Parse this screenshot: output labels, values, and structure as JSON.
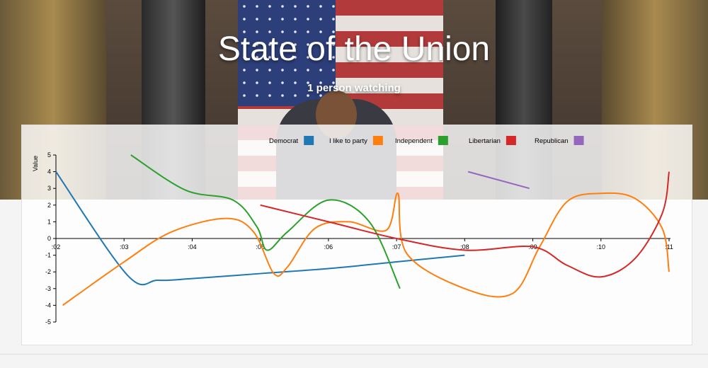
{
  "header": {
    "title": "State of the Union",
    "subtitle": "1 person watching"
  },
  "chart_data": {
    "type": "line",
    "ylabel": "Value",
    "xlabel": "",
    "ylim": [
      -5,
      5
    ],
    "x_ticks": [
      ":02",
      ":03",
      ":04",
      ":05",
      ":06",
      ":07",
      ":08",
      ":09",
      ":10",
      ":11"
    ],
    "y_ticks": [
      5,
      4,
      3,
      2,
      1,
      0,
      -1,
      -2,
      -3,
      -4,
      -5
    ],
    "legend_placement": "top",
    "series": [
      {
        "name": "Democrat",
        "color": "#1f77b4",
        "points": [
          [
            2.0,
            4.0
          ],
          [
            3.05,
            -2.2
          ],
          [
            3.5,
            -2.5
          ],
          [
            4.0,
            -2.4
          ],
          [
            5.0,
            -2.1
          ],
          [
            6.0,
            -1.8
          ],
          [
            7.0,
            -1.4
          ],
          [
            8.0,
            -1.0
          ]
        ]
      },
      {
        "name": "I like to party",
        "color": "#ff7f0e",
        "points": [
          [
            2.1,
            -4.0
          ],
          [
            3.0,
            -1.4
          ],
          [
            3.7,
            0.4
          ],
          [
            4.5,
            1.2
          ],
          [
            4.9,
            0.4
          ],
          [
            5.2,
            -2.1
          ],
          [
            5.4,
            -1.7
          ],
          [
            5.8,
            0.6
          ],
          [
            6.3,
            1.0
          ],
          [
            6.85,
            0.5
          ],
          [
            7.02,
            2.7
          ],
          [
            7.15,
            -0.9
          ],
          [
            8.0,
            -3.0
          ],
          [
            8.7,
            -3.3
          ],
          [
            9.1,
            -0.5
          ],
          [
            9.5,
            2.2
          ],
          [
            10.0,
            2.7
          ],
          [
            10.5,
            2.4
          ],
          [
            10.9,
            0.6
          ],
          [
            11.0,
            -2.0
          ]
        ]
      },
      {
        "name": "Independent",
        "color": "#2ca02c",
        "points": [
          [
            3.1,
            5.0
          ],
          [
            3.9,
            2.9
          ],
          [
            4.6,
            2.3
          ],
          [
            4.95,
            0.7
          ],
          [
            5.1,
            -0.7
          ],
          [
            5.4,
            0.4
          ],
          [
            6.0,
            2.3
          ],
          [
            6.6,
            1.0
          ],
          [
            7.05,
            -3.0
          ]
        ]
      },
      {
        "name": "Libertarian",
        "color": "#d62728",
        "points": [
          [
            5.0,
            2.0
          ],
          [
            6.0,
            1.0
          ],
          [
            7.0,
            0.0
          ],
          [
            8.0,
            -0.7
          ],
          [
            9.0,
            -0.5
          ],
          [
            9.5,
            -1.6
          ],
          [
            10.0,
            -2.3
          ],
          [
            10.5,
            -1.2
          ],
          [
            10.9,
            1.5
          ],
          [
            11.0,
            4.0
          ]
        ]
      },
      {
        "name": "Republican",
        "color": "#9467bd",
        "points": [
          [
            8.05,
            4.0
          ],
          [
            8.95,
            3.0
          ]
        ]
      }
    ]
  }
}
